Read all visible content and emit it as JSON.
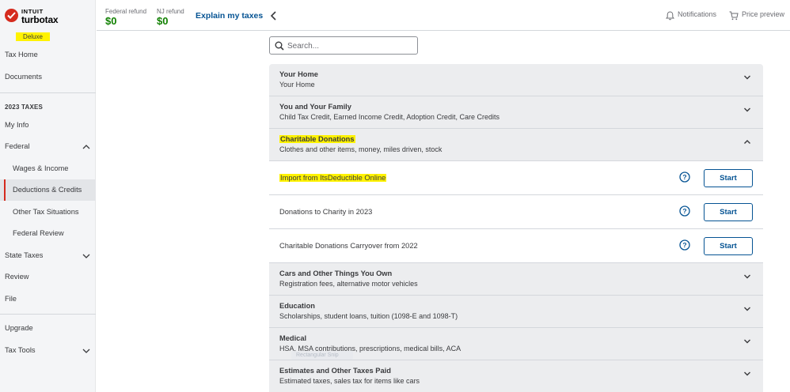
{
  "brand": {
    "company": "INTUIT",
    "product": "turbotax",
    "edition": "Deluxe"
  },
  "sidebar": {
    "items_top": [
      {
        "label": "Tax Home"
      },
      {
        "label": "Documents"
      }
    ],
    "section_title": "2023 TAXES",
    "items": [
      {
        "label": "My Info"
      },
      {
        "label": "Federal"
      },
      {
        "label": "Wages & Income"
      },
      {
        "label": "Deductions & Credits"
      },
      {
        "label": "Other Tax Situations"
      },
      {
        "label": "Federal Review"
      },
      {
        "label": "State Taxes"
      },
      {
        "label": "Review"
      },
      {
        "label": "File"
      }
    ],
    "items_bottom": [
      {
        "label": "Upgrade"
      },
      {
        "label": "Tax Tools"
      }
    ],
    "active_item": "Deductions & Credits"
  },
  "topbar": {
    "federal_refund_label": "Federal refund",
    "federal_refund_value": "$0",
    "state_refund_label": "NJ refund",
    "state_refund_value": "$0",
    "explain_link": "Explain my taxes",
    "notifications_label": "Notifications",
    "price_preview_label": "Price preview"
  },
  "search": {
    "placeholder": "Search..."
  },
  "categories": [
    {
      "title": "Your Home",
      "desc": "Your Home",
      "expanded": false
    },
    {
      "title": "You and Your Family",
      "desc": "Child Tax Credit, Earned Income Credit, Adoption Credit, Care Credits",
      "expanded": false
    },
    {
      "title": "Charitable Donations",
      "desc": "Clothes and other items, money, miles driven, stock",
      "expanded": true
    },
    {
      "title": "Cars and Other Things You Own",
      "desc": "Registration fees, alternative motor vehicles",
      "expanded": false
    },
    {
      "title": "Education",
      "desc": "Scholarships, student loans, tuition (1098-E and 1098-T)",
      "expanded": false
    },
    {
      "title": "Medical",
      "desc": "HSA, MSA contributions, prescriptions, medical bills, ACA",
      "expanded": false
    },
    {
      "title": "Estimates and Other Taxes Paid",
      "desc": "Estimated taxes, sales tax for items like cars",
      "expanded": false
    }
  ],
  "charitable_items": [
    {
      "label": "Import from ItsDeductible Online",
      "button": "Start"
    },
    {
      "label": "Donations to Charity in 2023",
      "button": "Start"
    },
    {
      "label": "Charitable Donations Carryover from 2022",
      "button": "Start"
    }
  ],
  "overlay_tag": "Rectangular Snip",
  "colors": {
    "accent_blue": "#055393",
    "refund_green": "#108000",
    "brand_red": "#d52b1e",
    "highlight_yellow": "#fff200"
  }
}
